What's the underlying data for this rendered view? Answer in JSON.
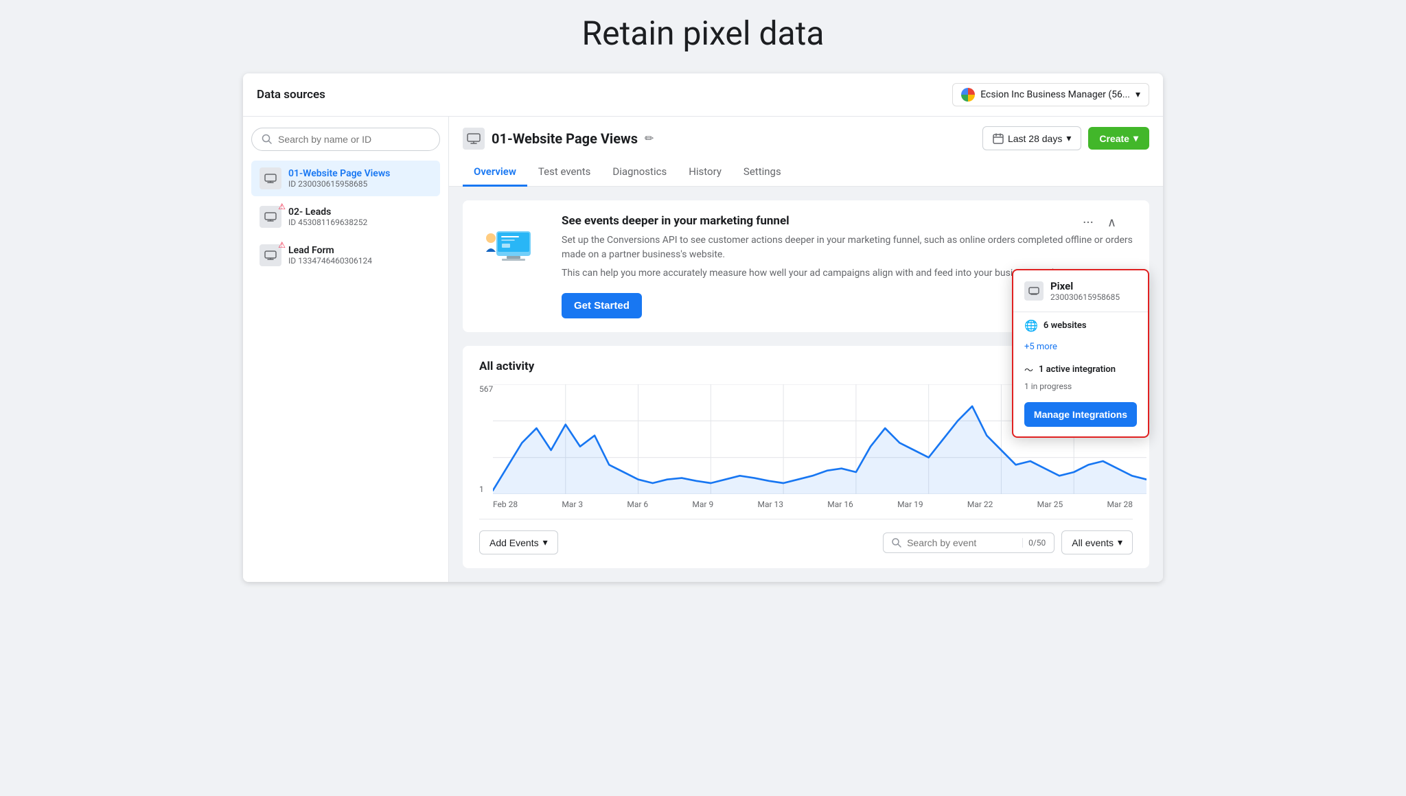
{
  "page": {
    "title": "Retain pixel data"
  },
  "top_bar": {
    "section_title": "Data sources",
    "business_label": "Ecsion Inc Business Manager (56...",
    "chevron": "▾"
  },
  "sidebar": {
    "search_placeholder": "Search by name or ID",
    "items": [
      {
        "id": "item-1",
        "name": "01-Website Page Views",
        "id_label": "ID 230030615958685",
        "active": true,
        "warning": false
      },
      {
        "id": "item-2",
        "name": "02- Leads",
        "id_label": "ID 453081169638252",
        "active": false,
        "warning": true
      },
      {
        "id": "item-3",
        "name": "Lead Form",
        "id_label": "ID 1334746460306124",
        "active": false,
        "warning": true
      }
    ]
  },
  "panel": {
    "title": "01-Website Page Views",
    "date_range": "Last 28 days",
    "create_label": "Create",
    "tabs": [
      "Overview",
      "Test events",
      "Diagnostics",
      "History",
      "Settings"
    ],
    "active_tab": "Overview"
  },
  "funnel_card": {
    "title": "See events deeper in your marketing funnel",
    "text1": "Set up the Conversions API to see customer actions deeper in your marketing funnel, such as online orders completed offline or orders made on a partner business's website.",
    "text2": "This can help you more accurately measure how well your ad campaigns align with and feed into your business goals.",
    "cta_label": "Get Started"
  },
  "activity": {
    "title": "All activity",
    "y_max": "567",
    "y_min": "1",
    "x_labels": [
      "Feb 28",
      "Mar 3",
      "Mar 6",
      "Mar 9",
      "Mar 13",
      "Mar 16",
      "Mar 19",
      "Mar 22",
      "Mar 25",
      "Mar 28"
    ],
    "chart_color": "#1877f2"
  },
  "bottom_bar": {
    "add_events_label": "Add Events",
    "search_placeholder": "Search by event",
    "event_count": "0/50",
    "filter_label": "All events"
  },
  "pixel_popup": {
    "name": "Pixel",
    "pixel_id": "230030615958685",
    "websites_label": "6 websites",
    "more_label": "+5 more",
    "integration_label": "1 active integration",
    "integration_sub": "1 in progress",
    "manage_label": "Manage Integrations"
  }
}
